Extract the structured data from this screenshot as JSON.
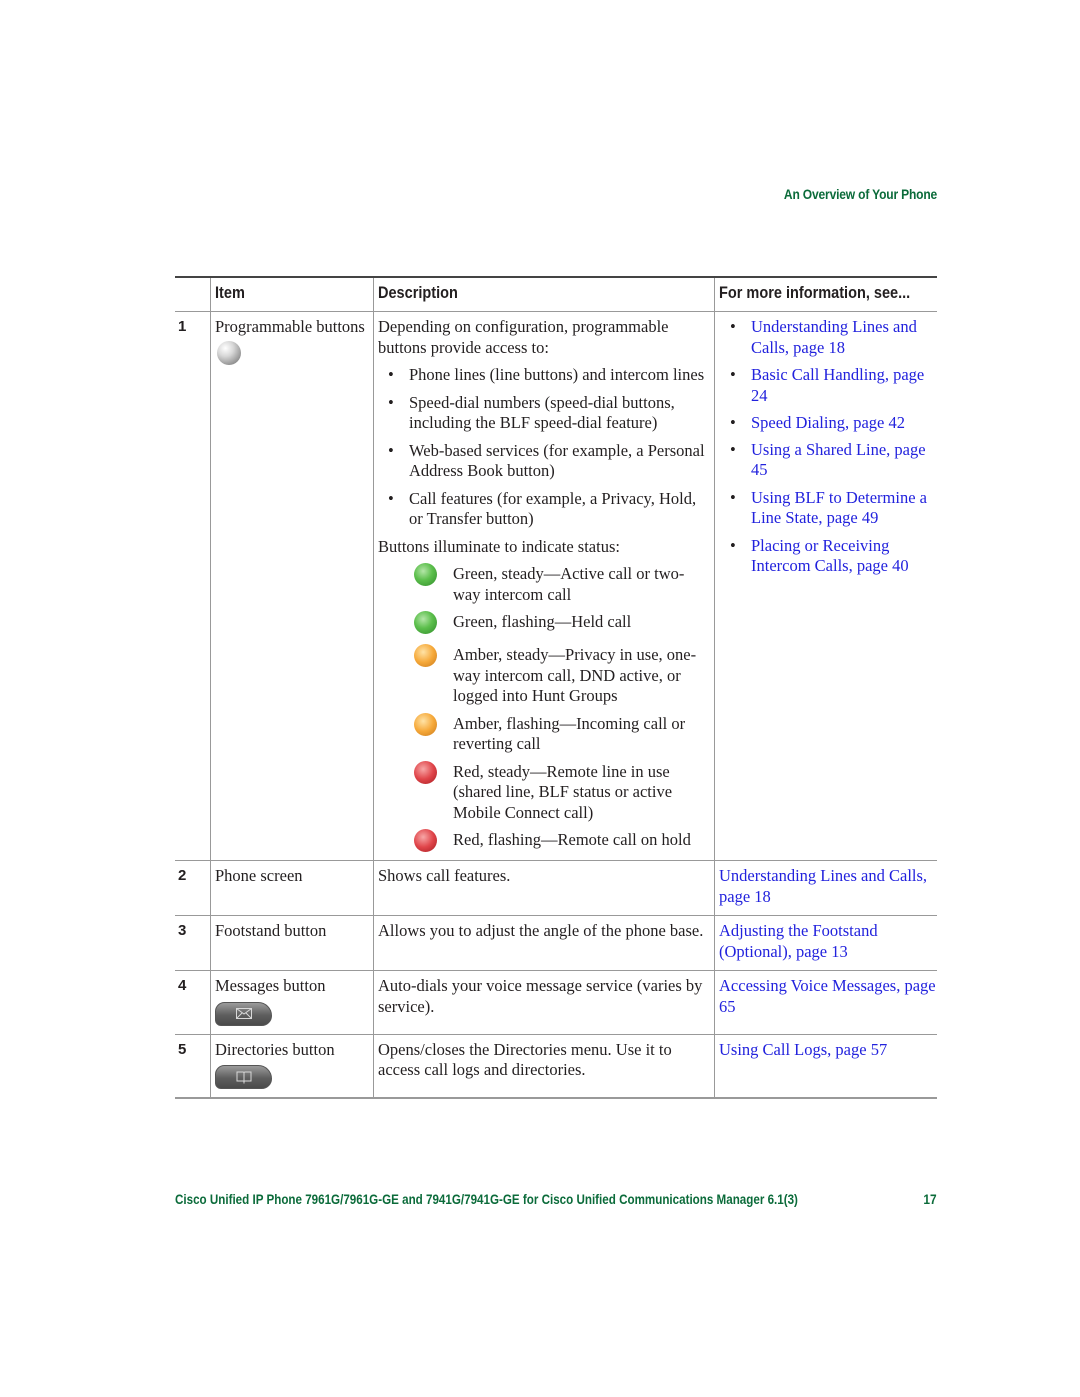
{
  "header": {
    "running_title": "An Overview of Your Phone"
  },
  "table": {
    "columns": [
      "Item",
      "Description",
      "For more information, see..."
    ],
    "rows": [
      {
        "number": "1",
        "item": "Programmable buttons",
        "icon": "programmable-button-icon",
        "description_intro": "Depending on configuration, programmable buttons provide access to:",
        "description_bullets": [
          "Phone lines (line buttons) and intercom lines",
          "Speed-dial numbers (speed-dial buttons, including the BLF speed-dial feature)",
          "Web-based services (for example, a Personal Address Book button)",
          "Call features (for example, a Privacy, Hold, or Transfer button)"
        ],
        "status_intro": "Buttons illuminate to indicate status:",
        "status_items": [
          {
            "color": "green",
            "hex": "#5cbf4c",
            "text": "Green, steady—Active call or two-way intercom call"
          },
          {
            "color": "green",
            "hex": "#5cbf4c",
            "text": "Green, flashing—Held call"
          },
          {
            "color": "amber",
            "hex": "#f6a93a",
            "text": "Amber, steady—Privacy in use, one-way intercom call, DND active, or logged into Hunt Groups"
          },
          {
            "color": "amber",
            "hex": "#f6a93a",
            "text": "Amber, flashing—Incoming call or reverting call"
          },
          {
            "color": "red",
            "hex": "#e0454a",
            "text": "Red, steady—Remote line in use (shared line, BLF status or active Mobile Connect call)"
          },
          {
            "color": "red",
            "hex": "#e0454a",
            "text": "Red, flashing—Remote call on hold"
          }
        ],
        "more_links": [
          "Understanding Lines and Calls, page 18",
          "Basic Call Handling, page 24",
          "Speed Dialing, page 42",
          "Using a Shared Line, page 45",
          "Using BLF to Determine a Line State, page 49",
          "Placing or Receiving Intercom Calls, page 40"
        ]
      },
      {
        "number": "2",
        "item": "Phone screen",
        "description": "Shows call features.",
        "more_link": "Understanding Lines and Calls, page 18"
      },
      {
        "number": "3",
        "item": "Footstand button",
        "description": "Allows you to adjust the angle of the phone base.",
        "more_link": "Adjusting the Footstand (Optional), page 13"
      },
      {
        "number": "4",
        "item": "Messages button",
        "icon": "messages-envelope-icon",
        "description": "Auto-dials your voice message service (varies by service).",
        "more_link": "Accessing Voice Messages, page 65"
      },
      {
        "number": "5",
        "item": "Directories button",
        "icon": "directories-book-icon",
        "description": "Opens/closes the Directories menu. Use it to access call logs and directories.",
        "more_link": "Using Call Logs, page 57"
      }
    ]
  },
  "footer": {
    "title": "Cisco Unified IP Phone 7961G/7961G-GE and 7941G/7941G-GE for Cisco Unified Communications Manager 6.1(3)",
    "page_number": "17"
  },
  "colors": {
    "heading_green": "#0b6b3a",
    "link_blue": "#2222dd"
  }
}
